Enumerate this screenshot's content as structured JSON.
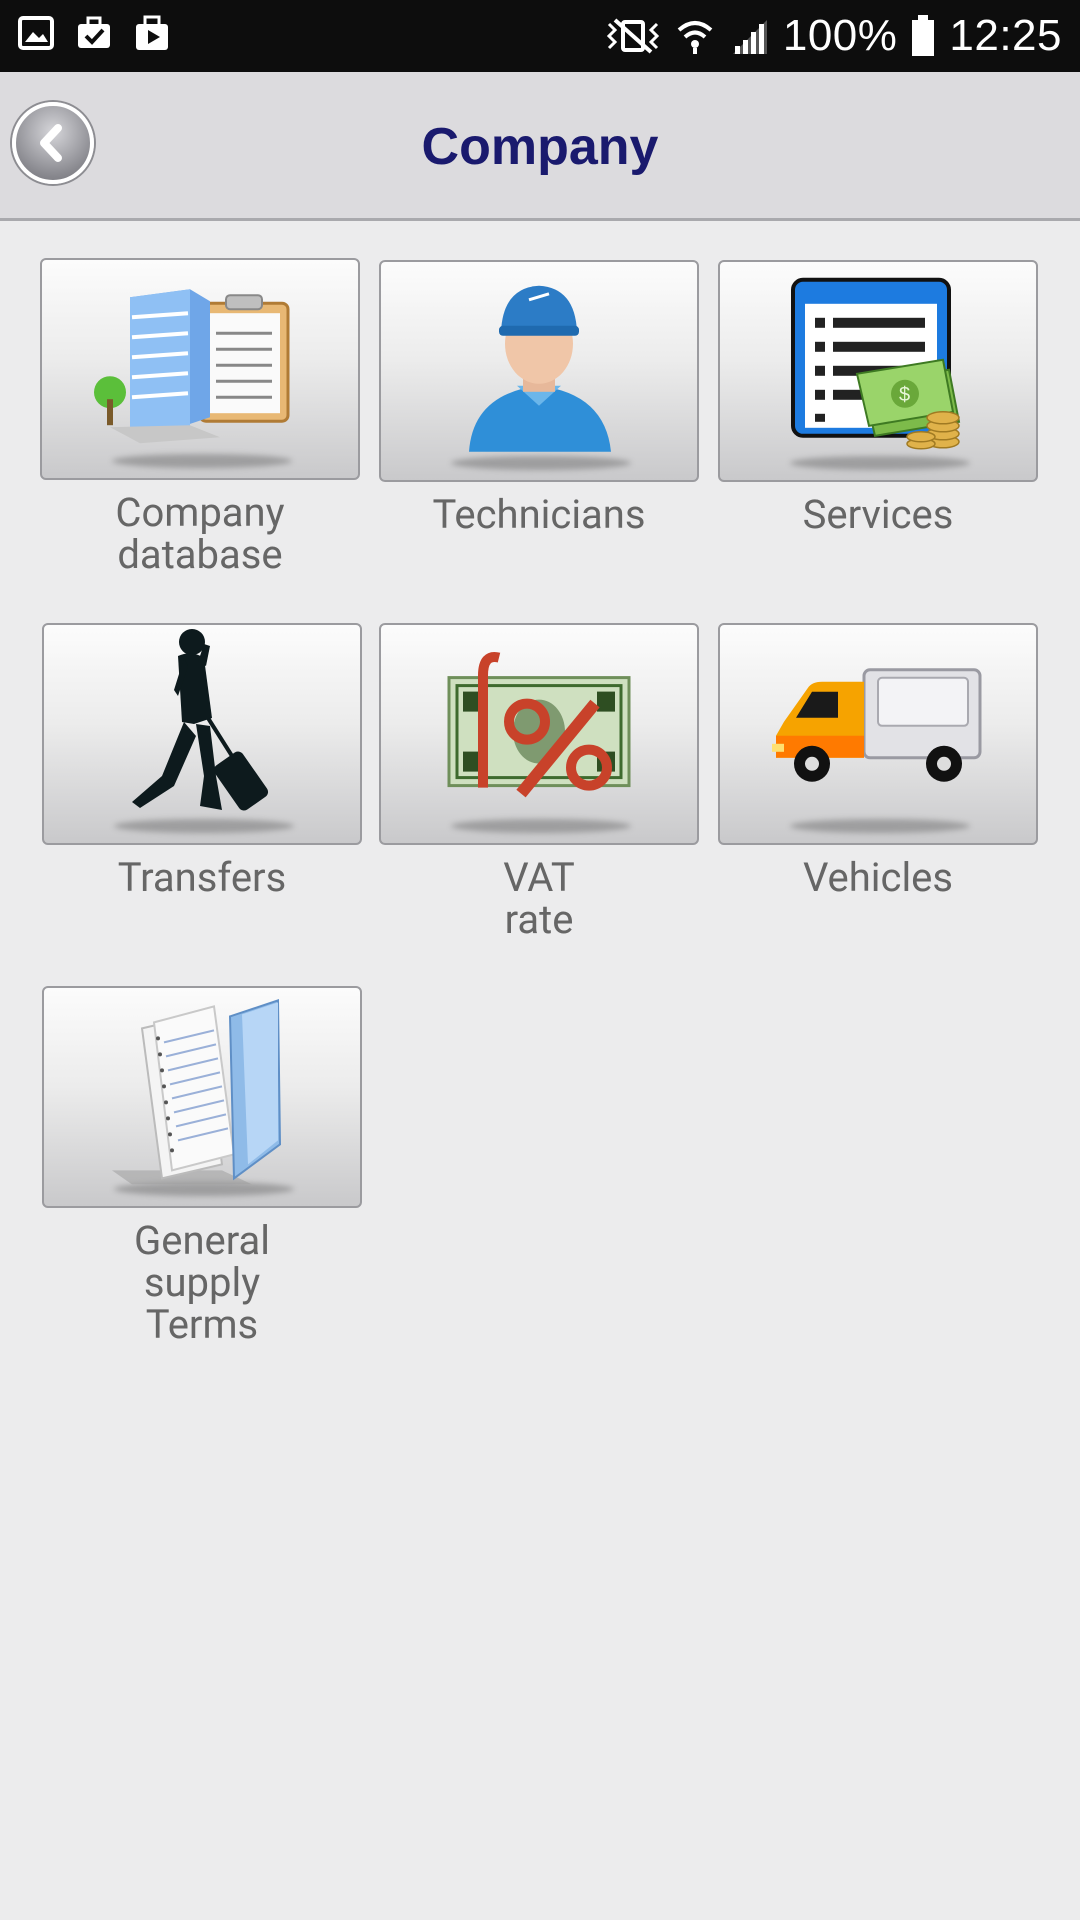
{
  "status_bar": {
    "battery": "100%",
    "time": "12:25",
    "left_icons": [
      "gallery-icon",
      "briefcase-check-icon",
      "play-store-icon"
    ],
    "right_icons": [
      "vibrate-mute-icon",
      "wifi-icon",
      "signal-icon",
      "battery-icon"
    ]
  },
  "header": {
    "title": "Company",
    "back_icon": "chevron-left-icon"
  },
  "tiles": [
    {
      "label": "Company\ndatabase",
      "icon": "building-clipboard-icon"
    },
    {
      "label": "Technicians",
      "icon": "technician-icon"
    },
    {
      "label": "Services",
      "icon": "services-list-money-icon"
    },
    {
      "label": "Transfers",
      "icon": "traveler-luggage-icon"
    },
    {
      "label": "VAT\nrate",
      "icon": "banknote-percent-icon"
    },
    {
      "label": "Vehicles",
      "icon": "truck-icon"
    },
    {
      "label": "General\nsupply\nTerms",
      "icon": "documents-folder-icon"
    }
  ],
  "colors": {
    "title": "#1a1a6e",
    "header_bg": "#dcdbde",
    "page_bg": "#ececed",
    "label": "#666666"
  }
}
